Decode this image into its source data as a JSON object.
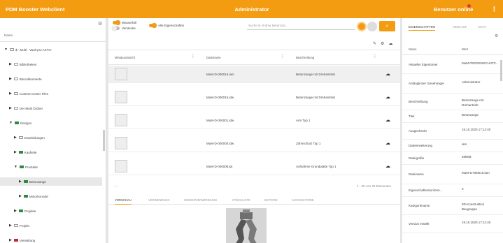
{
  "topbar": {
    "app_title": "PDM Booster Webclient",
    "center_title": "Administrator",
    "user_label": "Benutzer online",
    "more_glyph": "⋮"
  },
  "left": {
    "column_header": "Name",
    "tree": [
      {
        "label": "$ - Multi - Vault pro AKTIV",
        "level": 0,
        "arrow": "▼",
        "folder": "grey"
      },
      {
        "label": "Bibliotheken",
        "level": 1,
        "arrow": "▶",
        "folder": "grey"
      },
      {
        "label": "Büroobkumente",
        "level": 1,
        "arrow": "▶",
        "folder": "grey"
      },
      {
        "label": "Content Center Files",
        "level": 1,
        "arrow": "▶",
        "folder": "grey"
      },
      {
        "label": "Der Multi Ordner",
        "level": 1,
        "arrow": "▶",
        "folder": "grey"
      },
      {
        "label": "Designs",
        "level": 1,
        "arrow": "▼",
        "folder": "green"
      },
      {
        "label": "Entwicklungen",
        "level": 2,
        "arrow": "▶",
        "folder": "grey"
      },
      {
        "label": "Kaufteile",
        "level": 2,
        "arrow": "▶",
        "folder": "green"
      },
      {
        "label": "Produkte",
        "level": 2,
        "arrow": "▼",
        "folder": "green"
      },
      {
        "label": "Betonzange",
        "level": 3,
        "arrow": "▶",
        "folder": "green",
        "selected": true
      },
      {
        "label": "Motorkonsole",
        "level": 3,
        "arrow": "▶",
        "folder": "green"
      },
      {
        "label": "Projekte",
        "level": 2,
        "arrow": "▶",
        "folder": "green"
      },
      {
        "label": "Projekt",
        "level": 1,
        "arrow": "▶",
        "folder": "grey"
      },
      {
        "label": "Verwaltung",
        "level": 1,
        "arrow": "▶",
        "folder": "red"
      }
    ]
  },
  "mid": {
    "toggle_wasserfall": "Wasserfall",
    "toggle_verstecke": "Verstecke",
    "toggle_alle": "Alle Eigenschaften",
    "search_placeholder": "Suche in Ordner Betonzan...",
    "columns": [
      "Miniaturansicht",
      "Dateiname",
      "Beschreibung"
    ],
    "rows": [
      {
        "file": "MuM-D-000016.iam",
        "desc": "Betonzange mit Drehantrieb",
        "selected": true
      },
      {
        "file": "MuM-D-000016.idw",
        "desc": "Betonzange mit Drehantrieb"
      },
      {
        "file": "MuM-D-000001.idw",
        "desc": "Arm Typ 1"
      },
      {
        "file": "MuM-D-000000.idw",
        "desc": "Zahnschutz Typ 1"
      },
      {
        "file": "MuM-D-000008.ipt",
        "desc": "Aufnahme Grundplatte Typ 1"
      }
    ],
    "paging": "1 - 30 von 30 Elementen",
    "tabs": [
      "VORSCHAU",
      "VERWENDUNG",
      "WIEDERVERWENDUNG",
      "STÜCKLISTE",
      "HISTORIE",
      "SUCHHISTORIE"
    ]
  },
  "right": {
    "tabs": [
      "EIGENSCHAFTEN",
      "VERLAUF",
      "CHAT"
    ],
    "head_name": "Name",
    "head_value": "Wert",
    "props": [
      {
        "k": "Aktueller Eigentümer",
        "v": "MuM FBOGENSCHUTZ..."
      },
      {
        "k": "Anfänglicher Genehmiger",
        "v": "Administrator"
      },
      {
        "k": "Beschreibung",
        "v": "Betonzange mit Drehantrieb"
      },
      {
        "k": "Titel",
        "v": "Betonzange"
      },
      {
        "k": "Ausgecheckt",
        "v": "19.10.2020 17:12:40"
      },
      {
        "k": "Dateierweiterung",
        "v": "iam"
      },
      {
        "k": "Dateigröße",
        "v": "358KB"
      },
      {
        "k": "Dateiname",
        "v": "MuM-D-000016.iam"
      },
      {
        "k": "Eigenschaftenkonform...",
        "v": "0"
      },
      {
        "k": "Kategoriename",
        "v": "3D-Konstruktion Baugruppe"
      },
      {
        "k": "Version erstellt",
        "v": "19.10.2020 17:12:40"
      }
    ]
  }
}
